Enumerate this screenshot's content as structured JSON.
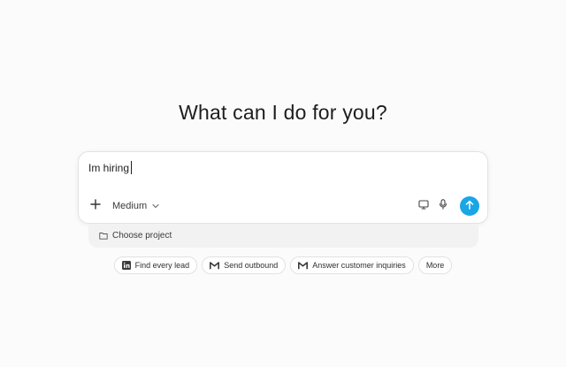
{
  "headline": "What can I do for you?",
  "composer": {
    "input_value": "Im hiring",
    "model_label": "Medium",
    "icons": {
      "add": "plus-icon",
      "model_dropdown": "chevron-down-icon",
      "computer": "monitor-icon",
      "voice": "microphone-icon",
      "send": "arrow-up-icon"
    },
    "send_color": "#1aa6e6"
  },
  "project": {
    "label": "Choose project",
    "icon": "folder-icon"
  },
  "suggestions": [
    {
      "label": "Find every lead",
      "icon": "linkedin-icon"
    },
    {
      "label": "Send outbound",
      "icon": "gmail-icon"
    },
    {
      "label": "Answer customer inquiries",
      "icon": "gmail-icon"
    },
    {
      "label": "More",
      "icon": ""
    }
  ]
}
